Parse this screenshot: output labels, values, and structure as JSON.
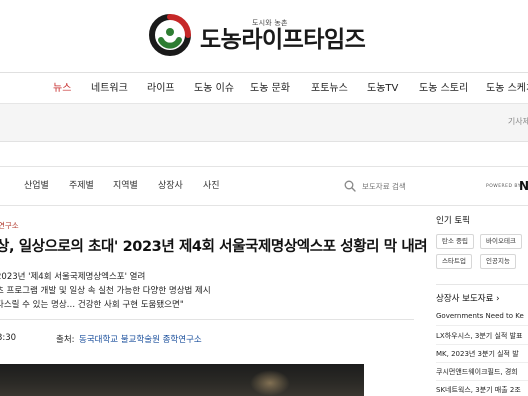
{
  "brand": {
    "small_text": "도시와 농촌",
    "name": "도농라이프타임즈",
    "colors": {
      "green": "#2e7d32",
      "red": "#c62828",
      "dark": "#1a1a1a"
    }
  },
  "nav": {
    "items": [
      "뉴스",
      "네트워크",
      "라이프",
      "도농 이슈",
      "도농 문화",
      "포토뉴스",
      "도농TV",
      "도농 스토리",
      "도농 스케치"
    ],
    "active": "뉴스"
  },
  "strip": {
    "right_text": "기사제"
  },
  "subnav": {
    "items": [
      "산업별",
      "주제별",
      "지역별",
      "상장사",
      "사진"
    ],
    "search_placeholder": "보도자료 검색",
    "search_icon": "search-icon",
    "powered_by": "POWERED BY",
    "powered_brand": "N"
  },
  "article": {
    "breadcrumb": "연구소",
    "headline": "상, 일상으로의 초대' 2023년 제4회 서울국제명상엑스포 성황리 막 내려",
    "sub_lines": [
      "2023년 '제4회 서울국제명상엑스포' 열려",
      "츠 프로그램 개발 및 일상 속 실천 가능한 다양한 명상법 제시",
      "다스릴 수 있는 명상… 건강한 사회 구현 도움됐으면\""
    ],
    "time": "3:30",
    "source_label": "출처:",
    "source": "동국대학교 불교학술원 종학연구소"
  },
  "sidebar": {
    "topics_title": "인기 토픽",
    "topics": [
      "탄소 중립",
      "바이오테크",
      "스타트업",
      "인공지능"
    ],
    "releases_title": "상장사 보도자료",
    "releases_arrow": "›",
    "releases": [
      "Governments Need to Ke",
      "LX하우시스, 3분기 실적 발표",
      "MK, 2023년 3분기 실적 발",
      "쿠시먼앤드웨이크필드, 경희",
      "SK네트웍스, 3분기 매출 2조"
    ]
  }
}
